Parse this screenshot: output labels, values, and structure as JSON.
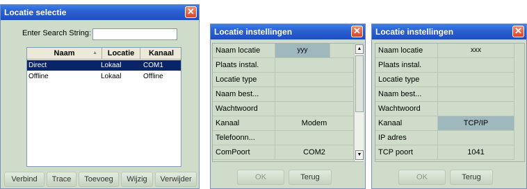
{
  "win1": {
    "title": "Locatie selectie",
    "search_label": "Enter Search String:",
    "search_value": "",
    "columns": [
      "Naam",
      "Locatie",
      "Kanaal"
    ],
    "sort_icon": "sort-arrow-icon",
    "rows": [
      {
        "naam": "Direct",
        "locatie": "Lokaal",
        "kanaal": "COM1",
        "selected": true
      },
      {
        "naam": "Offline",
        "locatie": "Lokaal",
        "kanaal": "Offline",
        "selected": false
      }
    ],
    "buttons": {
      "verbind": "Verbind",
      "trace": "Trace",
      "toevoeg": "Toevoeg",
      "wijzig": "Wijzig",
      "verwijder": "Verwijder"
    }
  },
  "win2": {
    "title": "Locatie instellingen",
    "rows": [
      {
        "name": "Naam locatie",
        "value": "yyy"
      },
      {
        "name": "Plaats instal.",
        "value": ""
      },
      {
        "name": "Locatie type",
        "value": ""
      },
      {
        "name": "Naam best...",
        "value": ""
      },
      {
        "name": "Wachtwoord",
        "value": ""
      },
      {
        "name": "Kanaal",
        "value": "Modem"
      },
      {
        "name": "Telefoonn...",
        "value": ""
      },
      {
        "name": "ComPoort",
        "value": "COM2"
      }
    ],
    "ok": "OK",
    "terug": "Terug"
  },
  "win3": {
    "title": "Locatie instellingen",
    "rows": [
      {
        "name": "Naam locatie",
        "value": "xxx"
      },
      {
        "name": "Plaats instal.",
        "value": ""
      },
      {
        "name": "Locatie type",
        "value": ""
      },
      {
        "name": "Naam best...",
        "value": ""
      },
      {
        "name": "Wachtwoord",
        "value": ""
      },
      {
        "name": "Kanaal",
        "value": "TCP/IP"
      },
      {
        "name": "IP adres",
        "value": ""
      },
      {
        "name": "TCP poort",
        "value": "1041"
      }
    ],
    "ok": "OK",
    "terug": "Terug"
  },
  "close_icon": "close-icon",
  "colors": {
    "titlebar": "#2a5fd0",
    "dialog_bg": "#cfdcc9",
    "selection": "#0a246a",
    "highlight_cell": "#9fb8bd"
  }
}
